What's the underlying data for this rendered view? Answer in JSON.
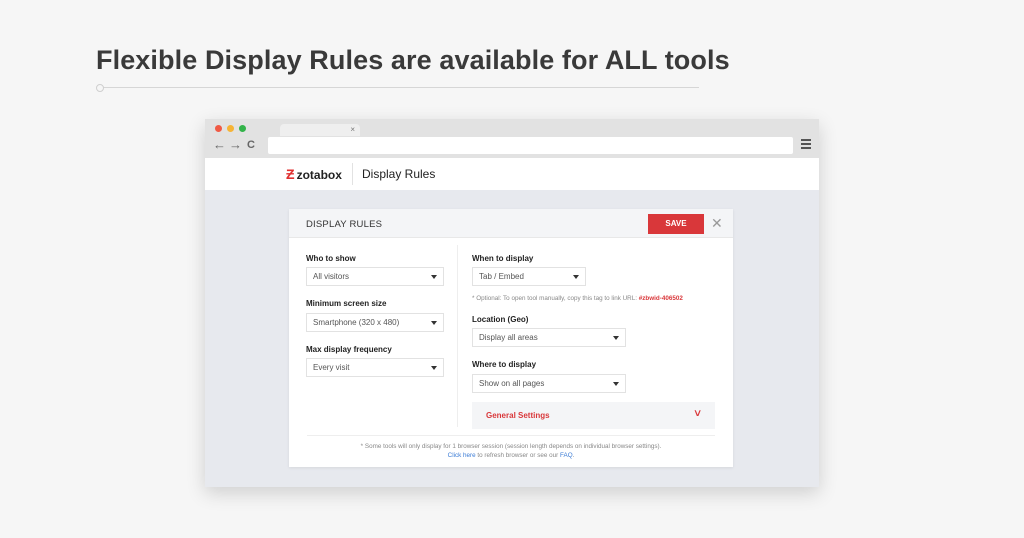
{
  "headline": "Flexible Display Rules are available for ALL tools",
  "browser": {
    "tab_close": "×",
    "back_icon": "←",
    "forward_icon": "→",
    "reload_icon": "C",
    "menu_icon": "hamburger-menu"
  },
  "app": {
    "logo_text": "zotabox",
    "title": "Display Rules"
  },
  "panel": {
    "title": "DISPLAY RULES",
    "save_label": "SAVE",
    "close_label": "✕",
    "left": {
      "who_label": "Who to show",
      "who_value": "All visitors",
      "min_screen_label": "Minimum screen size",
      "min_screen_value": "Smartphone (320 x 480)",
      "freq_label": "Max display frequency",
      "freq_value": "Every visit"
    },
    "right": {
      "when_label": "When to display",
      "when_value": "Tab / Embed",
      "note_text": "* Optional: To open tool manually, copy this tag to link URL: ",
      "note_code": "#zbwid-406502",
      "location_label": "Location (Geo)",
      "location_value": "Display all areas",
      "where_label": "Where to display",
      "where_value": "Show on all pages",
      "general_label": "General Settings",
      "general_chevron": "∨"
    },
    "footer": {
      "line1": "* Some tools will only display for 1 browser session (session length depends on individual browser settings).",
      "click_here": "Click here",
      "line2_mid": " to refresh browser or see our ",
      "faq": "FAQ",
      "line2_end": "."
    }
  },
  "colors": {
    "accent": "#d9373a",
    "link": "#3a7bd5",
    "background": "#f6f6f6"
  }
}
